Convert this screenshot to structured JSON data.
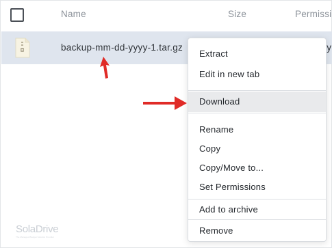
{
  "table": {
    "columns": {
      "name": "Name",
      "size": "Size",
      "permissions": "Permissi"
    },
    "row": {
      "file_name": "backup-mm-dd-yyyy-1.tar.gz",
      "perm_tail": "y"
    }
  },
  "context_menu": {
    "items": [
      {
        "label": "Extract"
      },
      {
        "label": "Edit in new tab"
      },
      {
        "label": "Download",
        "highlighted": true
      },
      {
        "label": "Rename"
      },
      {
        "label": "Copy"
      },
      {
        "label": "Copy/Move to..."
      },
      {
        "label": "Set Permissions"
      },
      {
        "label": "Add to archive"
      },
      {
        "label": "Remove"
      }
    ]
  },
  "brand": {
    "logo_text": "SolaDrive",
    "tagline": "The Managed Bodget Solution Provider"
  },
  "colors": {
    "selected_row": "#dfe5ee",
    "menu_highlight": "#e9eaec",
    "annotation_arrow": "#e02b27"
  }
}
